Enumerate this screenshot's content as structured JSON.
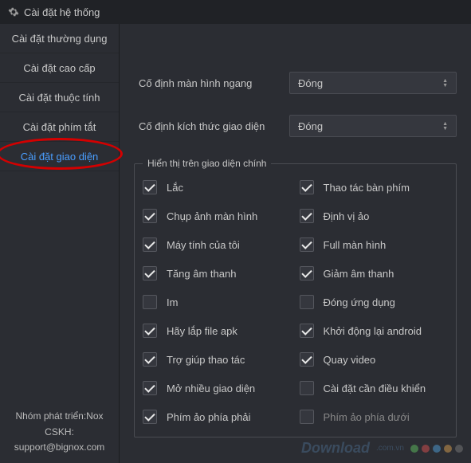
{
  "titlebar": {
    "title": "Cài đặt hệ thống"
  },
  "sidebar": {
    "items": [
      {
        "label": "Cài đặt thường dụng"
      },
      {
        "label": "Cài đặt cao cấp"
      },
      {
        "label": "Cài đặt thuộc tính"
      },
      {
        "label": "Cài đặt phím tắt"
      },
      {
        "label": "Cài đặt giao diện"
      }
    ]
  },
  "footer": {
    "line1": "Nhóm phát triển:Nox",
    "line2": "CSKH:",
    "line3": "support@bignox.com"
  },
  "form": {
    "fix_landscape": {
      "label": "Cố định màn hình ngang",
      "value": "Đóng"
    },
    "fix_size": {
      "label": "Cố định kích thức giao diện",
      "value": "Đóng"
    }
  },
  "group": {
    "legend": "Hiển thị trên giao diện chính",
    "items": [
      {
        "label": "Lắc",
        "checked": true
      },
      {
        "label": "Thao tác bàn phím",
        "checked": true
      },
      {
        "label": "Chụp ảnh màn hình",
        "checked": true
      },
      {
        "label": "Định vị ảo",
        "checked": true
      },
      {
        "label": "Máy tính của tôi",
        "checked": true
      },
      {
        "label": "Full màn hình",
        "checked": true
      },
      {
        "label": "Tăng âm thanh",
        "checked": true
      },
      {
        "label": "Giảm âm thanh",
        "checked": true
      },
      {
        "label": "Im",
        "checked": false
      },
      {
        "label": "Đóng ứng dụng",
        "checked": false
      },
      {
        "label": "Hãy lắp file apk",
        "checked": true
      },
      {
        "label": "Khởi động lại android",
        "checked": true
      },
      {
        "label": "Trợ giúp thao tác",
        "checked": true
      },
      {
        "label": "Quay video",
        "checked": true
      },
      {
        "label": "Mở nhiều giao diện",
        "checked": true
      },
      {
        "label": "Cài đặt cần điều khiển",
        "checked": false
      },
      {
        "label": "Phím ảo phía phải",
        "checked": true
      },
      {
        "label": "Phím ảo phía dưới",
        "checked": false,
        "disabled": true
      }
    ]
  },
  "watermark": {
    "text": "Download",
    "ext": ".com.vn"
  },
  "dot_colors": [
    "#5fbf5f",
    "#d94f4f",
    "#4f9fd9",
    "#d9a04f",
    "#7a7a7a"
  ]
}
